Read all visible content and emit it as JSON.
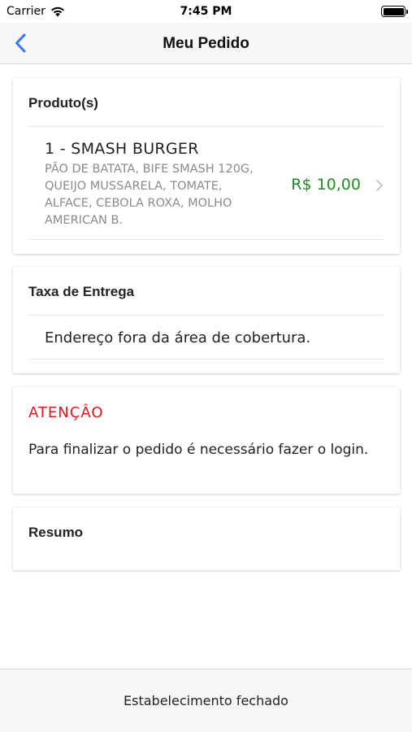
{
  "status_bar": {
    "carrier": "Carrier",
    "time": "7:45 PM"
  },
  "nav": {
    "title": "Meu Pedido",
    "back_icon": "chevron-left-icon",
    "accent_color": "#3478f6"
  },
  "products": {
    "title": "Produto(s)",
    "items": [
      {
        "name": "1 - SMASH BURGER",
        "description": "PÃO DE BATATA, BIFE SMASH 120G, QUEIJO MUSSARELA, TOMATE, ALFACE, CEBOLA ROXA, MOLHO AMERICAN B.",
        "price": "R$ 10,00"
      }
    ]
  },
  "delivery_fee": {
    "title": "Taxa de Entrega",
    "message": "Endereço fora da área de cobertura."
  },
  "attention": {
    "title": "ATENÇÂO",
    "message": "Para finalizar o pedido é necessário fazer o login.",
    "color": "#e8141b"
  },
  "summary": {
    "title": "Resumo"
  },
  "footer": {
    "status": "Estabelecimento fechado"
  },
  "colors": {
    "price": "#1f8f1f"
  }
}
